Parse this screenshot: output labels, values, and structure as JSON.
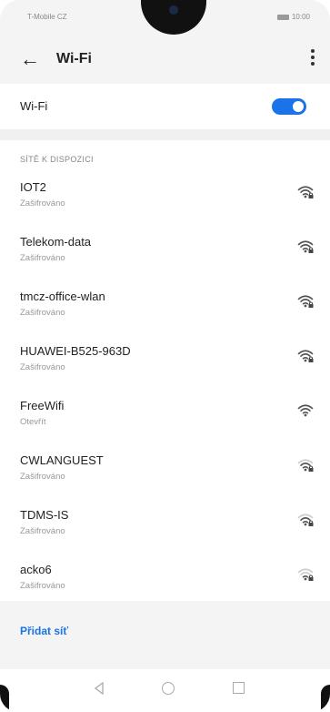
{
  "statusbar": {
    "carrier": "T-Mobile CZ",
    "time": "10:00"
  },
  "header": {
    "title": "Wi-Fi"
  },
  "wifi_toggle": {
    "label": "Wi-Fi",
    "state": "on"
  },
  "networks_section": {
    "title": "SÍTĚ K DISPOZICI",
    "items": [
      {
        "name": "IOT2",
        "status": "Zašifrováno",
        "signal": 3,
        "secured": true
      },
      {
        "name": "Telekom-data",
        "status": "Zašifrováno",
        "signal": 3,
        "secured": true
      },
      {
        "name": "tmcz-office-wlan",
        "status": "Zašifrováno",
        "signal": 3,
        "secured": true
      },
      {
        "name": "HUAWEI-B525-963D",
        "status": "Zašifrováno",
        "signal": 3,
        "secured": true
      },
      {
        "name": "FreeWifi",
        "status": "Otevřít",
        "signal": 3,
        "secured": false
      },
      {
        "name": "CWLANGUEST",
        "status": "Zašifrováno",
        "signal": 2,
        "secured": true
      },
      {
        "name": "TDMS-IS",
        "status": "Zašifrováno",
        "signal": 2,
        "secured": true
      },
      {
        "name": "acko6",
        "status": "Zašifrováno",
        "signal": 1,
        "secured": true
      }
    ]
  },
  "add_network": {
    "label": "Přidat síť"
  },
  "accent_color": "#1a73e8"
}
